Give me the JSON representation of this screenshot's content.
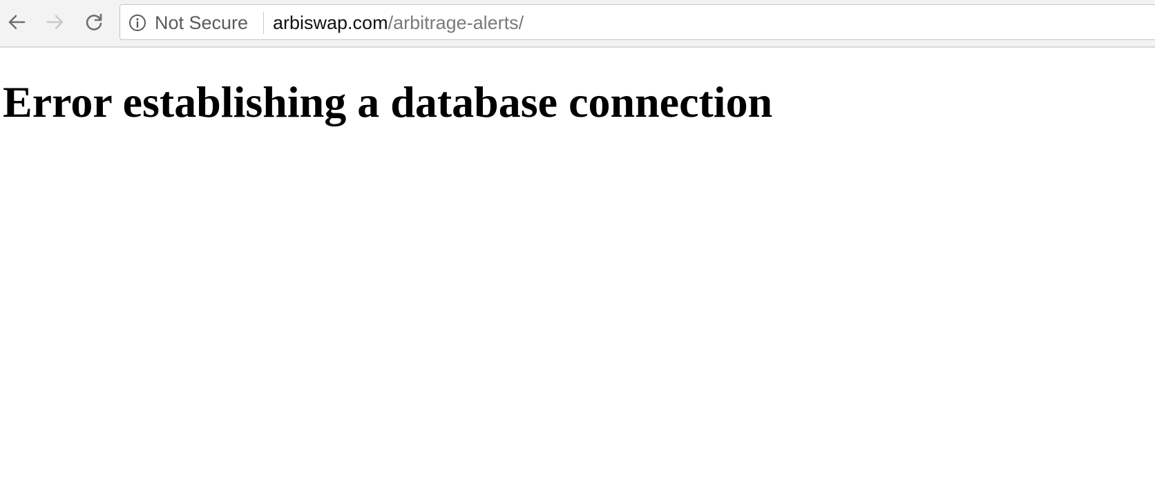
{
  "browser": {
    "nav": {
      "back_icon": "arrow-left-icon",
      "forward_icon": "arrow-right-icon",
      "reload_icon": "reload-icon"
    },
    "omnibox": {
      "info_icon": "info-circle-icon",
      "security_label": "Not Secure",
      "url_host": "arbiswap.com",
      "url_path": "/arbitrage-alerts/"
    }
  },
  "page": {
    "heading": "Error establishing a database connection"
  },
  "colors": {
    "toolbar_bg": "#f3f3f3",
    "nav_active": "#6e6e6e",
    "nav_disabled": "#c8c8c8",
    "url_host": "#111111",
    "url_path": "#7a7a7a"
  }
}
